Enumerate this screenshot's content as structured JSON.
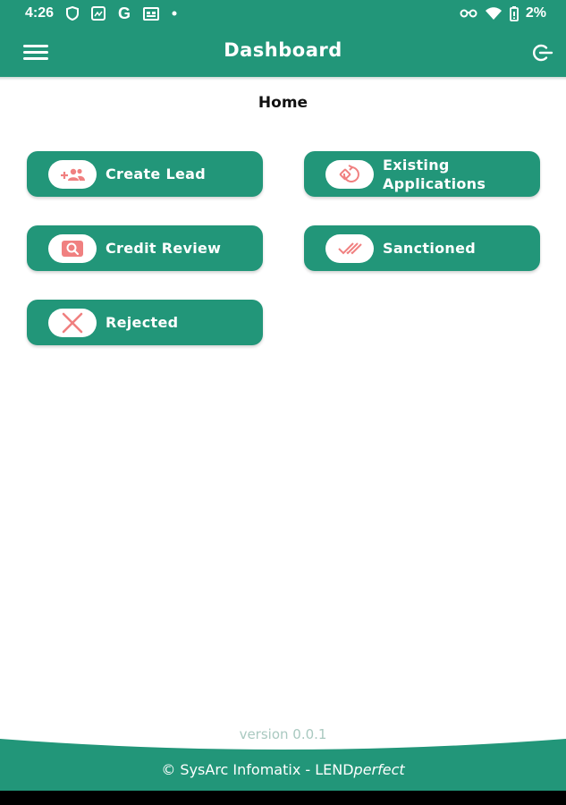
{
  "status_bar": {
    "time": "4:26",
    "battery": "2%",
    "icons": [
      "shield-icon",
      "image-icon",
      "google-icon",
      "calendar-icon",
      "dot-icon",
      "glasses-icon",
      "wifi-icon",
      "battery-icon"
    ]
  },
  "app_bar": {
    "title": "Dashboard",
    "menu_icon": "hamburger-menu-icon",
    "logout_icon": "logout-icon"
  },
  "page": {
    "title": "Home"
  },
  "tiles": [
    {
      "label": "Create Lead",
      "icon": "add-user-icon"
    },
    {
      "label": "Existing\nApplications",
      "icon": "existing-applications-icon"
    },
    {
      "label": "Credit Review",
      "icon": "search-icon"
    },
    {
      "label": "Sanctioned",
      "icon": "double-check-icon"
    },
    {
      "label": "Rejected",
      "icon": "close-icon"
    }
  ],
  "footer": {
    "version": "version 0.0.1",
    "copyright": "© SysArc Infomatix - LEND",
    "brand_italic": "perfect"
  },
  "colors": {
    "primary": "#229679",
    "icon_accent": "#f08080",
    "version_text": "#a9c9c0"
  }
}
